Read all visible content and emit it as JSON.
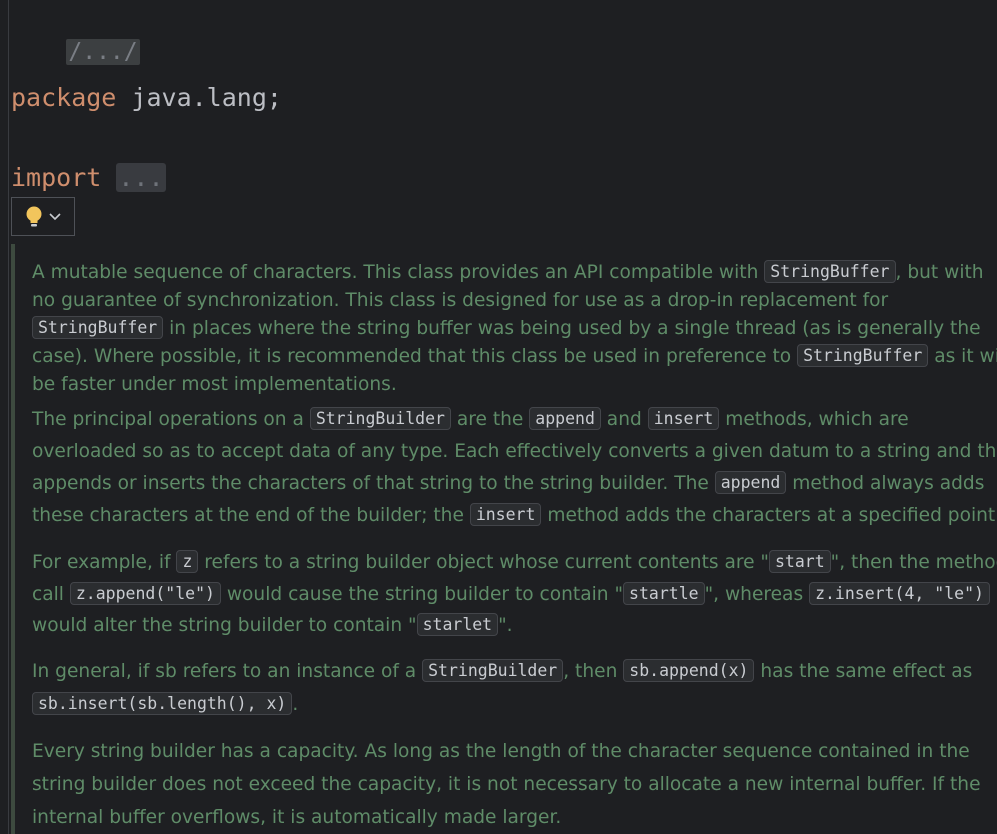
{
  "editor": {
    "header_fold": "/.../",
    "package_keyword": "package",
    "package_name": " java.lang;",
    "import_keyword": "import",
    "import_fold": "..."
  },
  "intention": {
    "bulb_icon": "lightbulb-icon",
    "chevron_icon": "chevron-down-icon"
  },
  "doc": {
    "p1": {
      "l1a": "A mutable sequence of characters. This class provides an API compatible with ",
      "l1c": "StringBuffer",
      "l1b": ", but with",
      "l2": "no guarantee of synchronization. This class is designed for use as a drop-in replacement for",
      "l3c": "StringBuffer",
      "l3a": " in places where the string buffer was being used by a single thread (as is generally the",
      "l4a": "case). Where possible, it is recommended that this class be used in preference to ",
      "l4c": "StringBuffer",
      "l4b": " as it will",
      "l5": "be faster under most implementations."
    },
    "p2": {
      "l1a": "The principal operations on a ",
      "l1c1": "StringBuilder",
      "l1b": " are the ",
      "l1c2": "append",
      "l1d": " and ",
      "l1c3": "insert",
      "l1e": " methods, which are",
      "l2": "overloaded so as to accept data of any type. Each effectively converts a given datum to a string and then",
      "l3a": "appends or inserts the characters of that string to the string builder. The ",
      "l3c": "append",
      "l3b": " method always adds",
      "l4a": "these characters at the end of the builder; the ",
      "l4c": "insert",
      "l4b": " method adds the characters at a specified point."
    },
    "p3": {
      "l1a": "For example, if ",
      "l1c1": "z",
      "l1b": " refers to a string builder object whose current contents are \"",
      "l1c2": "start",
      "l1d": "\", then the method",
      "l2a": "call ",
      "l2c1": "z.append(\"le\")",
      "l2b": " would cause the string builder to contain \"",
      "l2c2": "startle",
      "l2d": "\", whereas ",
      "l2c3": "z.insert(4, \"le\")",
      "l3a": "would alter the string builder to contain \"",
      "l3c": "starlet",
      "l3b": "\"."
    },
    "p4": {
      "l1a": "In general, if sb refers to an instance of a ",
      "l1c1": "StringBuilder",
      "l1b": ", then ",
      "l1c2": "sb.append(x)",
      "l1d": " has the same effect as",
      "l2c": "sb.insert(sb.length(), x)",
      "l2a": "."
    },
    "p5": {
      "l1": "Every string builder has a capacity. As long as the length of the character sequence contained in the",
      "l2": "string builder does not exceed the capacity, it is not necessary to allocate a new internal buffer. If the",
      "l3": "internal buffer overflows, it is automatically made larger."
    }
  }
}
